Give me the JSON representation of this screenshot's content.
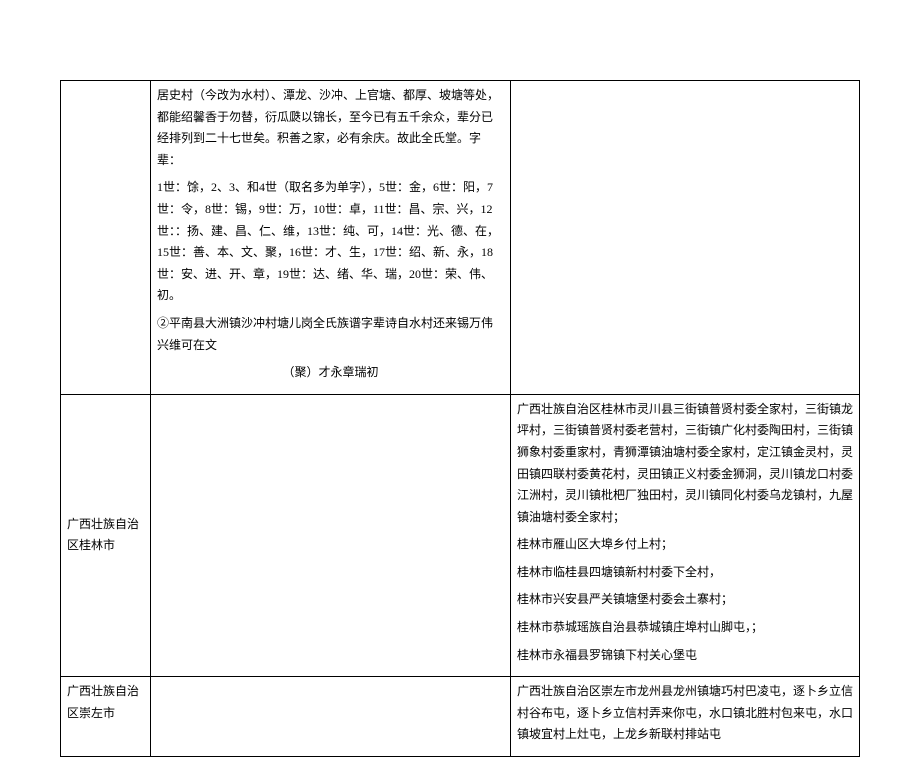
{
  "rows": [
    {
      "col1": "",
      "col2_paragraphs": [
        "居史村（今改为水村）、潭龙、沙冲、上官塘、都厚、坡塘等处，都能绍馨香于勿替，衍瓜瓞以锦长，至今已有五千余众，辈分已经排列到二十七世矣。积善之家，必有余庆。故此全氏堂。字辈：",
        "1世：馀，2、3、和4世（取名多为单字），5世：金，6世：阳，7世：令，8世：锡，9世：万，10世：卓，11世：昌、宗、兴，12世：：扬、建、昌、仁、维，13世：纯、可，14世：光、德、在，15世：善、本、文、聚，16世：才、生，17世：绍、新、永，18世：安、进、开、章，19世：达、绪、华、瑞，20世：荣、伟、初。",
        "②平南县大洲镇沙冲村塘儿岗全氏族谱字辈诗自水村还来锡万伟兴维可在文",
        "（聚）才永章瑞初"
      ],
      "col2_center_last": true,
      "col3_paragraphs": []
    },
    {
      "col1": "广西壮族自治区桂林市",
      "col2_paragraphs": [],
      "col3_paragraphs": [
        "广西壮族自治区桂林市灵川县三街镇普贤村委全家村，三街镇龙坪村，三街镇普贤村委老营村，三街镇广化村委陶田村，三街镇狮象村委重家村，青狮潭镇油塘村委全家村，定江镇金灵村，灵田镇四联村委黄花村，灵田镇正义村委金狮洞，灵川镇龙口村委江洲村，灵川镇枇杷厂独田村，灵川镇同化村委乌龙镇村，九屋镇油塘村委全家村；",
        "桂林市雁山区大埠乡付上村；",
        "桂林市临桂县四塘镇新村村委下全村，",
        "桂林市兴安县严关镇塘堡村委会土寨村；",
        "桂林市恭城瑶族自治县恭城镇庄埠村山脚屯，；",
        "桂林市永福县罗锦镇下村关心堡屯"
      ]
    },
    {
      "col1": "广西壮族自治区崇左市",
      "col2_paragraphs": [],
      "col3_paragraphs": [
        "广西壮族自治区崇左市龙州县龙州镇塘巧村巴凌屯，逐卜乡立信村谷布屯，逐卜乡立信村弄来你屯，水口镇北胜村包来屯，水口镇坡宜村上灶屯，上龙乡新联村排站屯"
      ]
    }
  ]
}
